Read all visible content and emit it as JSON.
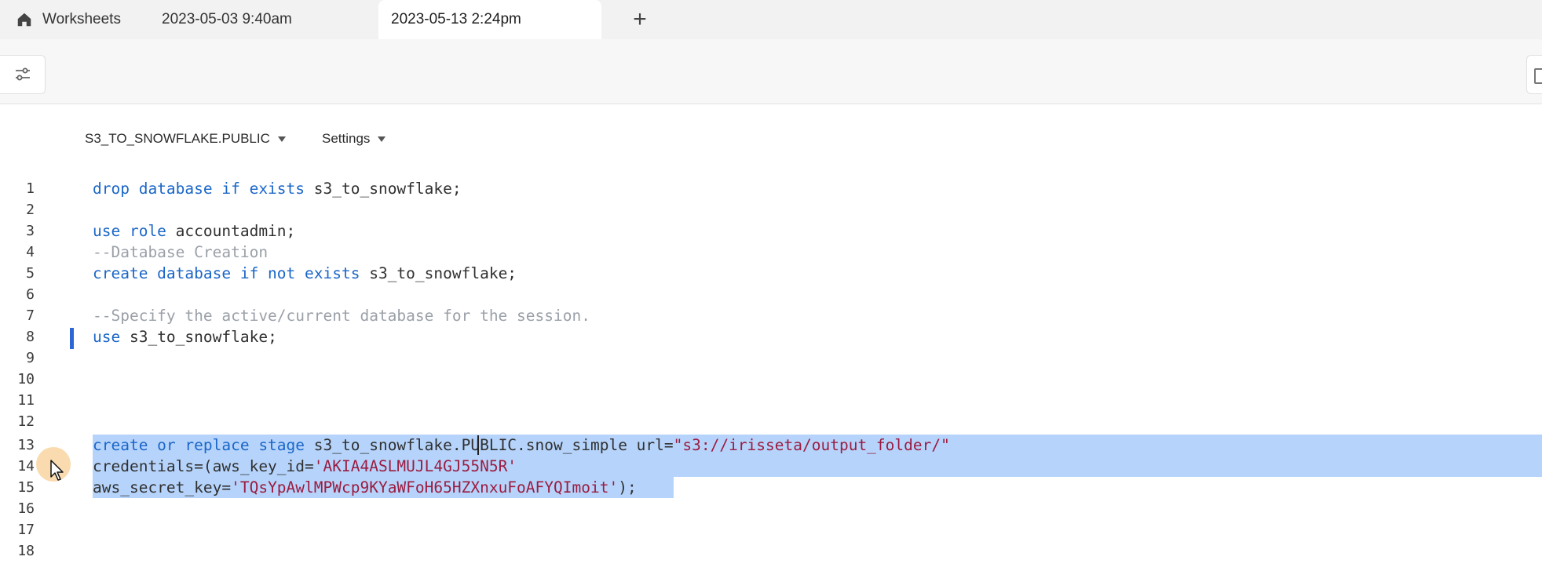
{
  "tabs": {
    "home_label": "Worksheets",
    "tab1_label": "2023-05-03 9:40am",
    "tab2_label": "2023-05-13 2:24pm",
    "add_label": "+"
  },
  "context": {
    "database": "S3_TO_SNOWFLAKE.PUBLIC",
    "settings": "Settings"
  },
  "editor": {
    "line_numbers": [
      "1",
      "2",
      "3",
      "4",
      "5",
      "6",
      "7",
      "8",
      "9",
      "10",
      "11",
      "12",
      "13",
      "14",
      "15",
      "16",
      "17",
      "18"
    ],
    "lines": {
      "l1": {
        "kw": "drop database if exists",
        "rest": " s3_to_snowflake;"
      },
      "l3": {
        "kw": "use role",
        "rest": " accountadmin;"
      },
      "l4": {
        "comment": "--Database Creation"
      },
      "l5": {
        "kw": "create database if not exists",
        "rest": " s3_to_snowflake;"
      },
      "l7": {
        "comment": "--Specify the active/current database for the session."
      },
      "l8": {
        "kw": "use",
        "rest": " s3_to_snowflake;"
      },
      "l13": {
        "kw": "create or replace stage",
        "rest": " s3_to_snowflake.PUBLIC.snow_simple url=",
        "str": "\"s3://irisseta/output_folder/\""
      },
      "l14": {
        "rest": "credentials=(aws_key_id=",
        "str": "'AKIA4ASLMUJL4GJ55N5R'"
      },
      "l15": {
        "rest": "aws_secret_key=",
        "str": "'TQsYpAwlMPWcp9KYaWFoH65HZXnxuFoAFYQImoit'",
        "tail": ");"
      }
    }
  },
  "colors": {
    "keyword": "#1a66c8",
    "comment": "#9ba0a8",
    "string": "#9b1c40",
    "selection": "#b6d4fb"
  },
  "icons": {
    "home": "home-icon",
    "filter": "sliders-icon",
    "add": "plus-icon",
    "panel": "panel-toggle-icon",
    "cursor": "mouse-pointer-icon"
  }
}
